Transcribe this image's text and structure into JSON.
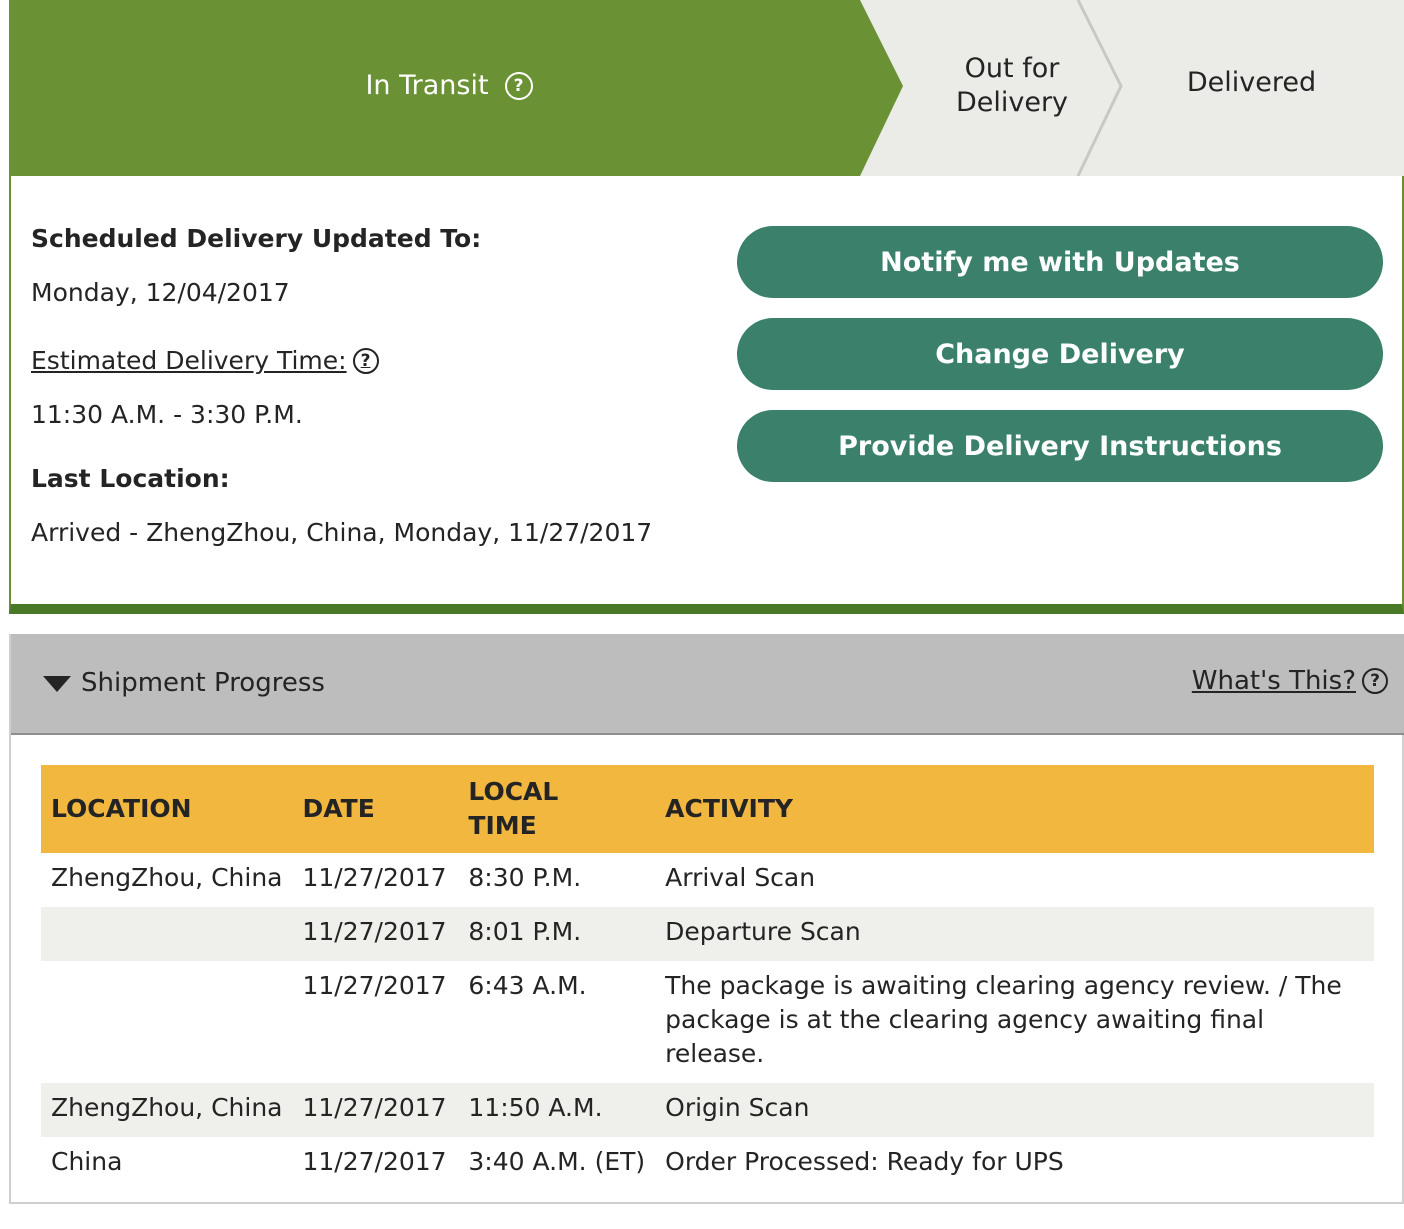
{
  "progress_steps": {
    "in_transit": "In Transit",
    "out_for_delivery_line1": "Out for",
    "out_for_delivery_line2": "Delivery",
    "delivered": "Delivered"
  },
  "summary": {
    "scheduled_label": "Scheduled Delivery Updated To:",
    "scheduled_value": "Monday, 12/04/2017",
    "estimated_label": "Estimated Delivery Time:",
    "estimated_value": "11:30 A.M. - 3:30 P.M.",
    "last_location_label": "Last Location:",
    "last_location_value": "Arrived - ZhengZhou, China, Monday, 11/27/2017"
  },
  "actions": {
    "notify": "Notify me with Updates",
    "change": "Change Delivery",
    "instructions": "Provide Delivery Instructions"
  },
  "shipment_progress": {
    "title": "Shipment Progress",
    "whats_this": "What's This?",
    "columns": {
      "location": "LOCATION",
      "date": "DATE",
      "local_time_line1": "LOCAL",
      "local_time_line2": "TIME",
      "activity": "ACTIVITY"
    },
    "rows": [
      {
        "location": "ZhengZhou,  China",
        "date": "11/27/2017",
        "time": "8:30 P.M.",
        "activity": "Arrival Scan"
      },
      {
        "location": "",
        "date": "11/27/2017",
        "time": "8:01 P.M.",
        "activity": "Departure Scan"
      },
      {
        "location": "",
        "date": "11/27/2017",
        "time": "6:43 A.M.",
        "activity": "The package is awaiting clearing agency review. / The package is at the clearing agency awaiting final release."
      },
      {
        "location": "ZhengZhou,  China",
        "date": "11/27/2017",
        "time": "11:50 A.M.",
        "activity": "Origin Scan"
      },
      {
        "location": "China",
        "date": "11/27/2017",
        "time": "3:40 A.M. (ET)",
        "activity": "Order Processed: Ready for UPS"
      }
    ]
  },
  "icons": {
    "help": "question-circle-icon",
    "toggle": "triangle-down-icon"
  },
  "colors": {
    "in_transit_green": "#6a9134",
    "inactive_step": "#ebebe7",
    "button_teal": "#3a806a",
    "table_header": "#f2b73f",
    "section_header": "#bdbdbd"
  }
}
